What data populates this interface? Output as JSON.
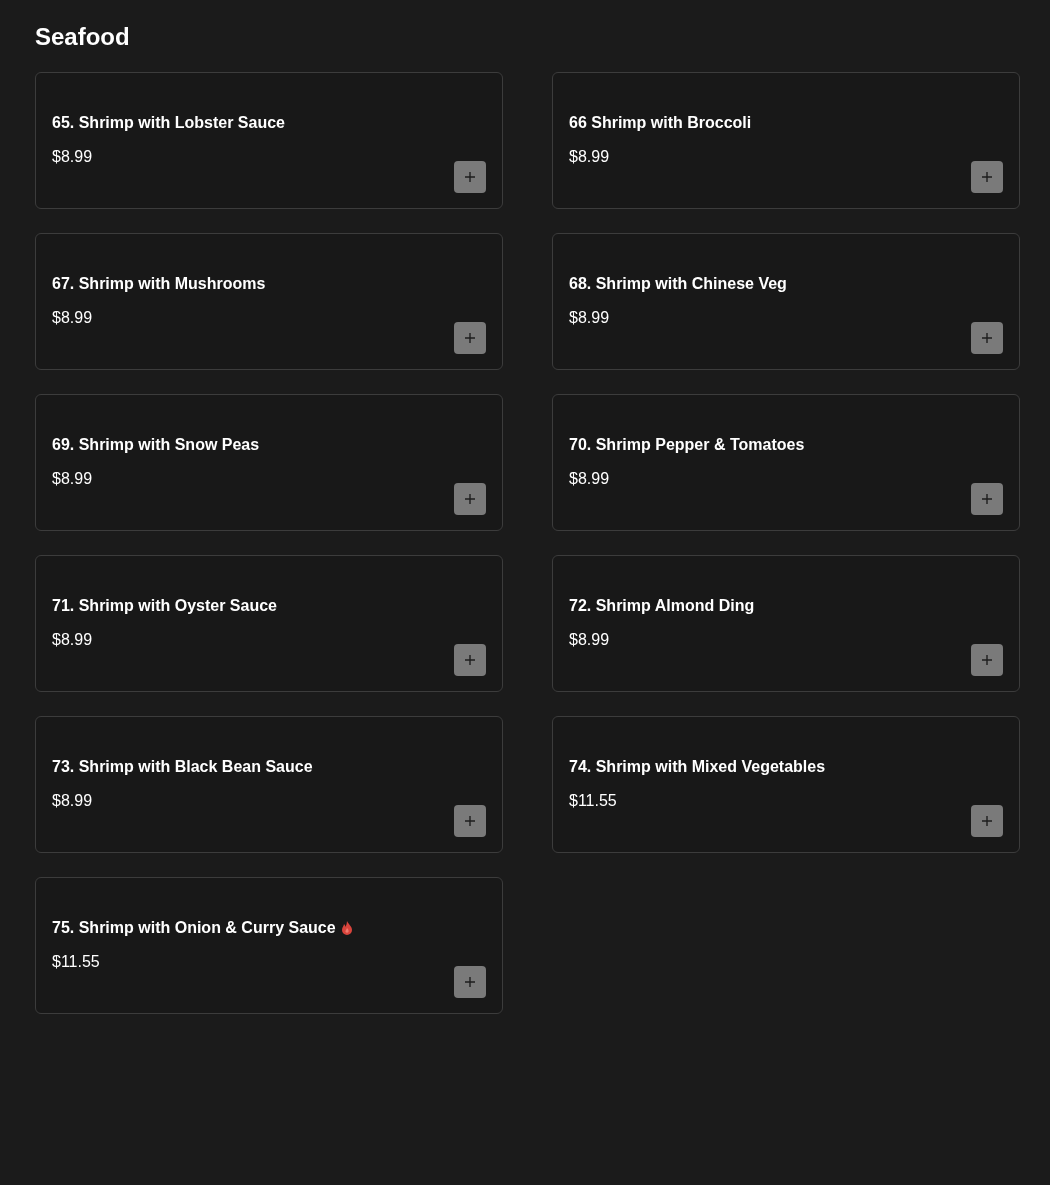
{
  "section": {
    "title": "Seafood"
  },
  "items": [
    {
      "name": "65. Shrimp with Lobster Sauce",
      "price": "$8.99",
      "spicy": false
    },
    {
      "name": "66 Shrimp with Broccoli",
      "price": "$8.99",
      "spicy": false
    },
    {
      "name": "67. Shrimp with Mushrooms",
      "price": "$8.99",
      "spicy": false
    },
    {
      "name": "68. Shrimp with Chinese Veg",
      "price": "$8.99",
      "spicy": false
    },
    {
      "name": "69. Shrimp with Snow Peas",
      "price": "$8.99",
      "spicy": false
    },
    {
      "name": "70. Shrimp Pepper & Tomatoes",
      "price": "$8.99",
      "spicy": false
    },
    {
      "name": "71. Shrimp with Oyster Sauce",
      "price": "$8.99",
      "spicy": false
    },
    {
      "name": "72. Shrimp Almond Ding",
      "price": "$8.99",
      "spicy": false
    },
    {
      "name": "73. Shrimp with Black Bean Sauce",
      "price": "$8.99",
      "spicy": false
    },
    {
      "name": "74. Shrimp with Mixed Vegetables",
      "price": "$11.55",
      "spicy": false
    },
    {
      "name": "75. Shrimp with Onion & Curry Sauce",
      "price": "$11.55",
      "spicy": true
    }
  ]
}
